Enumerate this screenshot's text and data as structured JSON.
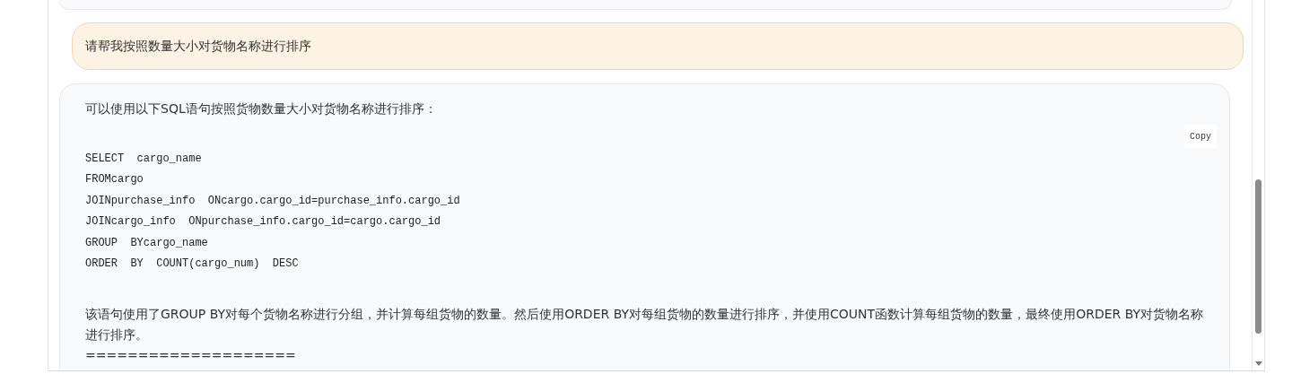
{
  "user_message": {
    "text": "请帮我按照数量大小对货物名称进行排序"
  },
  "assistant_message": {
    "intro": "可以使用以下SQL语句按照货物数量大小对货物名称进行排序：",
    "code": {
      "copy_button": "Copy",
      "lines": [
        "SELECT  cargo_name",
        "FROMcargo",
        "JOINpurchase_info  ONcargo.cargo_id=purchase_info.cargo_id",
        "JOINcargo_info  ONpurchase_info.cargo_id=cargo.cargo_id",
        "GROUP  BYcargo_name",
        "ORDER  BY  COUNT(cargo_num)  DESC"
      ]
    },
    "paragraphs": [
      "该语句使用了GROUP BY对每个货物名称进行分组，并计算每组货物的数量。然后使用ORDER BY对每组货物的数量进行排序，并使用COUNT函数计算每组货物的数量，最终使用ORDER BY对货物名称进行排序。",
      "===================="
    ]
  }
}
